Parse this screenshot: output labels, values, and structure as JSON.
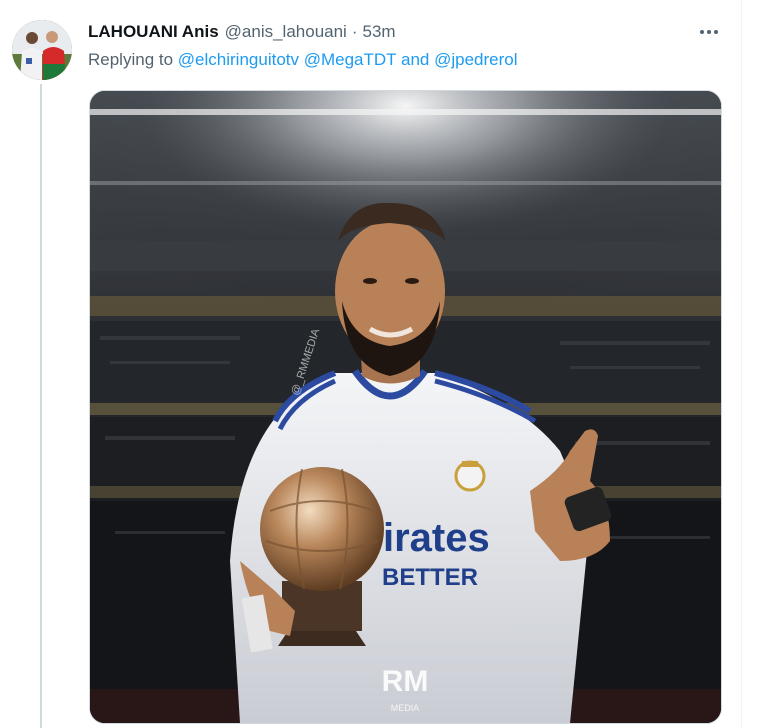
{
  "tweet": {
    "display_name": "LAHOUANI Anis",
    "handle": "@anis_lahouani",
    "separator": "·",
    "time": "53m",
    "replying_prefix": "Replying to",
    "mentions": [
      "@elchiringuitotv",
      "@MegaTDT"
    ],
    "mention_joiner": "and",
    "last_mention": "@jpedrerol"
  },
  "media": {
    "sponsor_text_1": "irates",
    "sponsor_text_2": "BETTER",
    "watermark_logo": "RM",
    "watermark_sub": "MEDIA",
    "watermark_handle": "@_RMMEDIA"
  },
  "colors": {
    "link": "#1d9bf0",
    "secondary_text": "#536471",
    "thread_line": "#cfd9de"
  },
  "icons": {
    "more": "more-horizontal-icon"
  }
}
